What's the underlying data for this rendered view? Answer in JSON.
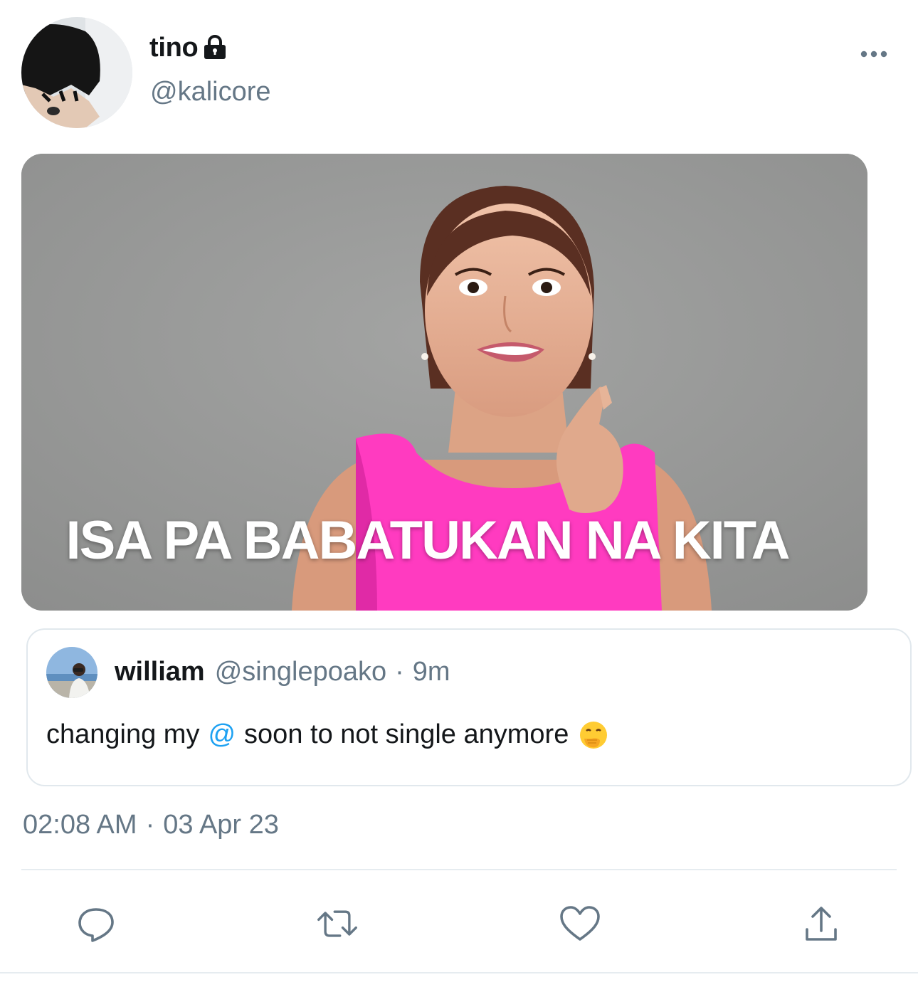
{
  "author": {
    "name": "tino",
    "handle": "@kalicore",
    "protected_icon": "lock-icon"
  },
  "media": {
    "caption": "ISA PA BABATUKAN NA KITA"
  },
  "quoted_tweet": {
    "name": "william",
    "handle": "@singlepoako",
    "separator": "·",
    "time": "9m",
    "text_before": "changing my",
    "mention": "@",
    "text_after": "soon to not single anymore",
    "emoji_icon": "face-with-hand-over-mouth-emoji"
  },
  "timestamp": {
    "time": "02:08 AM",
    "separator": "·",
    "date": "03 Apr 23"
  },
  "actions": [
    {
      "icon": "reply-icon"
    },
    {
      "icon": "retweet-icon"
    },
    {
      "icon": "like-icon"
    },
    {
      "icon": "share-icon"
    }
  ],
  "colors": {
    "text": "#14171a",
    "secondary": "#657786",
    "accent": "#1da1f2",
    "border": "#e1e8ed",
    "caption_bg_shirt": "#ff3bc0"
  }
}
